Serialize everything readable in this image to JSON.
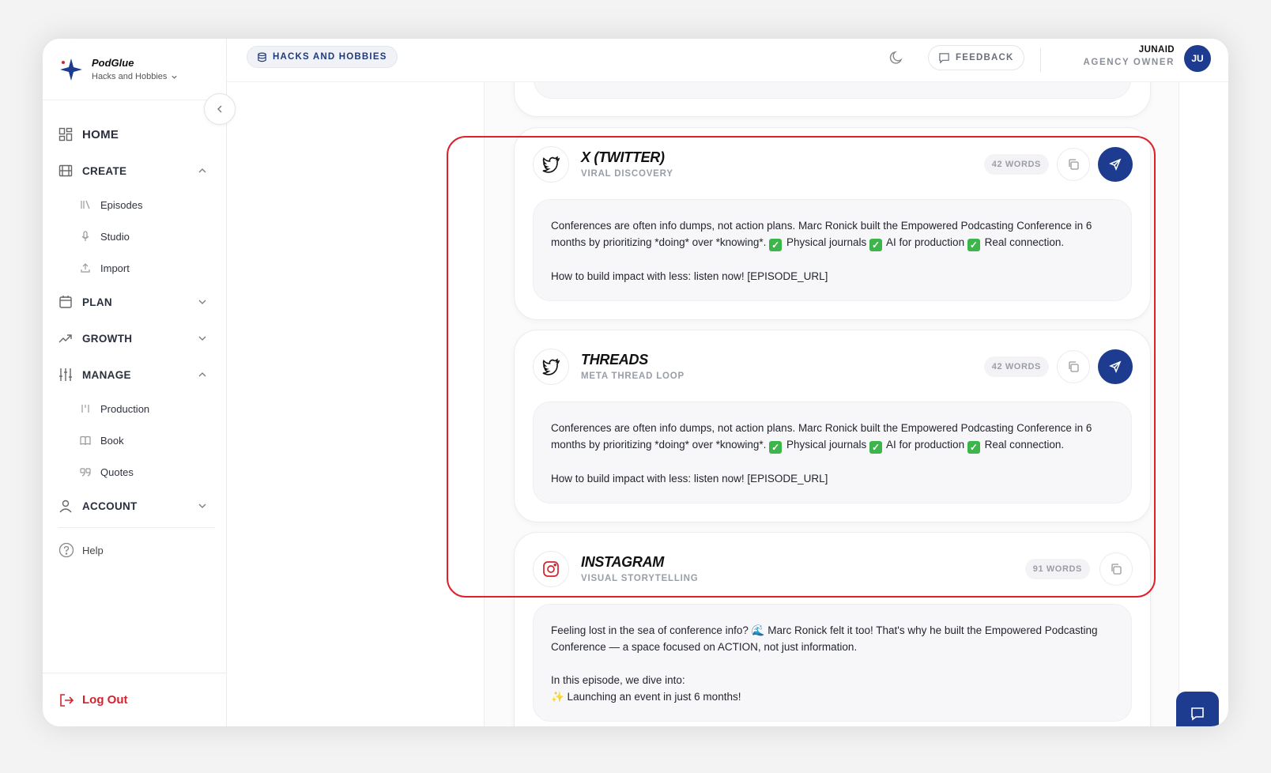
{
  "brand": {
    "name": "PodGlue",
    "show": "Hacks and Hobbies"
  },
  "sidebar": {
    "home": "HOME",
    "create": "CREATE",
    "create_items": [
      "Episodes",
      "Studio",
      "Import"
    ],
    "plan": "PLAN",
    "growth": "GROWTH",
    "manage": "MANAGE",
    "manage_items": [
      "Production",
      "Book",
      "Quotes"
    ],
    "account": "ACCOUNT",
    "help": "Help",
    "logout": "Log Out"
  },
  "topbar": {
    "show_pill": "HACKS AND HOBBIES",
    "feedback": "FEEDBACK",
    "user_name": "JUNAID",
    "user_role": "AGENCY OWNER",
    "avatar_initials": "JU"
  },
  "cards": [
    {
      "platform": "X (TWITTER)",
      "subtitle": "VIRAL DISCOVERY",
      "words": "42 WORDS",
      "icon": "twitter-icon",
      "line1": "Conferences are often info dumps, not action plans. Marc Ronick built the Empowered Podcasting Conference in 6 months by prioritizing *doing* over *knowing*.",
      "checks": [
        "Physical journals",
        "AI for production",
        "Real connection."
      ],
      "line2": "How to build impact with less: listen now! [EPISODE_URL]"
    },
    {
      "platform": "THREADS",
      "subtitle": "META THREAD LOOP",
      "words": "42 WORDS",
      "icon": "twitter-icon",
      "line1": "Conferences are often info dumps, not action plans. Marc Ronick built the Empowered Podcasting Conference in 6 months by prioritizing *doing* over *knowing*.",
      "checks": [
        "Physical journals",
        "AI for production",
        "Real connection."
      ],
      "line2": "How to build impact with less: listen now! [EPISODE_URL]"
    },
    {
      "platform": "INSTAGRAM",
      "subtitle": "VISUAL STORYTELLING",
      "words": "91 WORDS",
      "icon": "instagram-icon",
      "para1": "Feeling lost in the sea of conference info? 🌊 Marc Ronick felt it too! That's why he built the Empowered Podcasting Conference — a space focused on ACTION, not just information.",
      "para2": "In this episode, we dive into:",
      "bullet1": "✨ Launching an event in just 6 months!"
    }
  ],
  "colors": {
    "accent": "#1d3c8f",
    "danger": "#d3232f",
    "highlight": "#e0202b",
    "check": "#3cb54a"
  }
}
